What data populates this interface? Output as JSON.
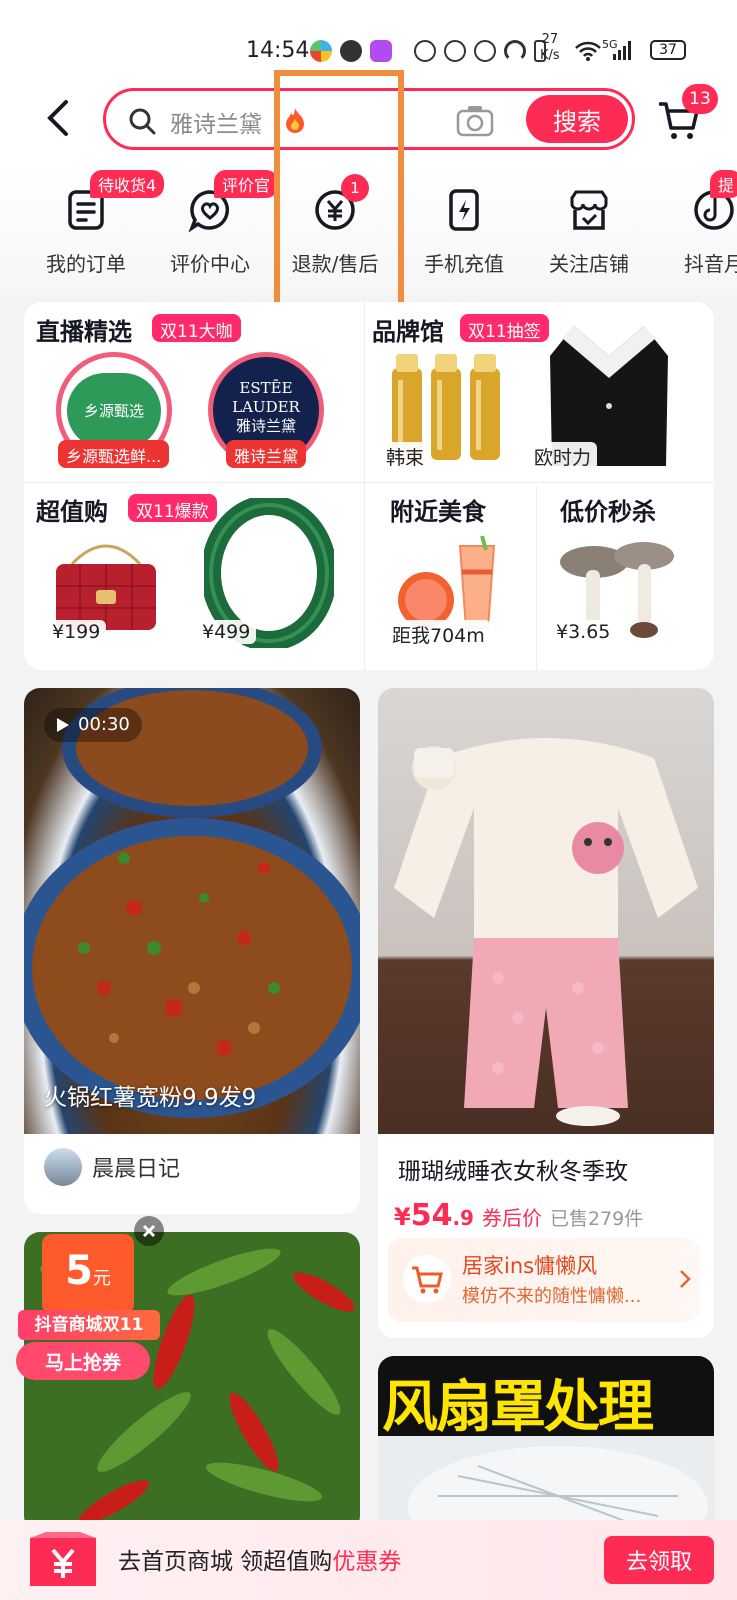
{
  "status_bar": {
    "time": "14:54",
    "speed_value": "27",
    "speed_unit": "K/s",
    "network": "5G",
    "battery": "37"
  },
  "search": {
    "placeholder": "雅诗兰黛",
    "button": "搜索",
    "cart_count": "13"
  },
  "quick_actions": [
    {
      "label": "我的订单",
      "tag": "待收货4",
      "icon": "order-list-icon"
    },
    {
      "label": "评价中心",
      "tag": "评价官",
      "icon": "review-heart-icon"
    },
    {
      "label": "退款/售后",
      "count": "1",
      "icon": "refund-yen-icon"
    },
    {
      "label": "手机充值",
      "icon": "phone-charge-icon"
    },
    {
      "label": "关注店铺",
      "icon": "shop-follow-icon"
    },
    {
      "label": "抖音月",
      "tag": "提",
      "icon": "douyin-monthly-icon"
    }
  ],
  "shortcuts": {
    "live": {
      "title": "直播精选",
      "pill": "双11大咖",
      "shops": [
        "乡源甄选鲜...",
        "雅诗兰黛"
      ],
      "logo1_text": "乡源甄选",
      "logo2_line1": "ESTĒE",
      "logo2_line2": "LAUDER",
      "logo2_line3": "雅诗兰黛"
    },
    "brand": {
      "title": "品牌馆",
      "pill": "双11抽签",
      "items": [
        "韩束",
        "欧时力"
      ]
    },
    "value": {
      "title": "超值购",
      "pill": "双11爆款",
      "prices": [
        "¥199",
        "¥499"
      ]
    },
    "food": {
      "title": "附近美食",
      "distance": "距我704m"
    },
    "flash": {
      "title": "低价秒杀",
      "price": "¥3.65"
    }
  },
  "feed": {
    "video": {
      "duration": "00:30",
      "caption": "火锅红薯宽粉9.9发9",
      "author": "晨晨日记"
    },
    "product": {
      "title": "珊瑚绒睡衣女秋冬季玫",
      "currency": "¥",
      "price_int": "54",
      "price_dec": ".9",
      "after_coupon": "券后价",
      "sold": "已售279件",
      "promo_title": "居家ins慵懒风",
      "promo_sub": "模仿不来的随性慵懒..."
    },
    "coupon_float": {
      "amount": "5",
      "unit": "元",
      "event": "抖音商城双11",
      "cta": "马上抢券"
    },
    "banner": {
      "title": "风扇罩处理"
    }
  },
  "bottom_banner": {
    "text": "去首页商城 领超值购",
    "highlight": "优惠券",
    "button": "去领取"
  },
  "colors": {
    "brand_red": "#fe2c55",
    "highlight_box": "#f08d3f"
  }
}
